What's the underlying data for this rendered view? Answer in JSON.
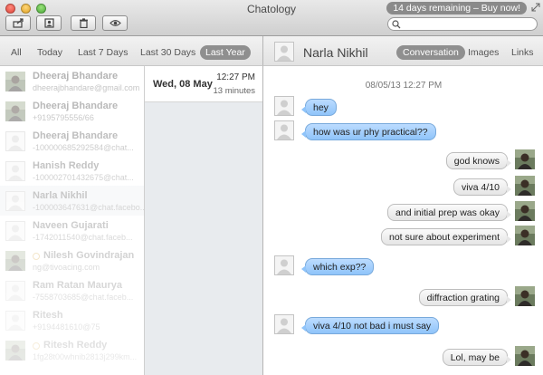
{
  "window": {
    "title": "Chatology",
    "promo": "14 days remaining – Buy now!"
  },
  "toolbar": {
    "buttons": [
      "share-icon",
      "contacts-icon",
      "trash-icon",
      "eye-icon"
    ]
  },
  "search": {
    "value": "",
    "placeholder": ""
  },
  "filters": [
    "All",
    "Today",
    "Last 7 Days",
    "Last 30 Days",
    "Last Year"
  ],
  "active_filter": "Last Year",
  "contacts": [
    {
      "name": "Dheeraj Bhandare",
      "sub": "dheerajbhandare@gmail.com",
      "avatar": "photo",
      "status": false
    },
    {
      "name": "Dheeraj Bhandare",
      "sub": "+9195795556/66",
      "avatar": "photo",
      "status": false
    },
    {
      "name": "Dheeraj Bhandare",
      "sub": "-100000685292584@chat...",
      "avatar": "blank",
      "status": false
    },
    {
      "name": "Hanish Reddy",
      "sub": "-100002701432675@chat...",
      "avatar": "blank",
      "status": false
    },
    {
      "name": "Narla Nikhil",
      "sub": "-100003647631@chat.facebo...",
      "avatar": "blank",
      "status": false,
      "selected": true
    },
    {
      "name": "Naveen Gujarati",
      "sub": "-1742011540@chat.faceb...",
      "avatar": "blank",
      "status": false
    },
    {
      "name": "Nilesh Govindrajan",
      "sub": "ng@tivoacing.com",
      "avatar": "photo",
      "status": true
    },
    {
      "name": "Ram Ratan Maurya",
      "sub": "-7558703685@chat.faceb...",
      "avatar": "blank",
      "status": false
    },
    {
      "name": "Ritesh",
      "sub": "+9194481610@75",
      "avatar": "blank",
      "status": false
    },
    {
      "name": "Ritesh Reddy",
      "sub": "1fg28t00whnib2813j299km...",
      "avatar": "photo",
      "status": true
    }
  ],
  "dates": [
    {
      "label": "Wed, 08 May",
      "time": "12:27 PM",
      "duration": "13 minutes"
    }
  ],
  "conversation": {
    "name": "Narla Nikhil",
    "tabs": [
      "Conversation",
      "Images",
      "Links"
    ],
    "active_tab": "Conversation",
    "timestamp": "08/05/13 12:27 PM",
    "messages": [
      {
        "dir": "in",
        "text": "hey"
      },
      {
        "dir": "in",
        "text": "how was ur phy practical??"
      },
      {
        "dir": "out",
        "text": "god knows"
      },
      {
        "dir": "out",
        "text": "viva 4/10"
      },
      {
        "dir": "out",
        "text": "and initial prep was okay"
      },
      {
        "dir": "out",
        "text": "not sure about experiment"
      },
      {
        "dir": "in",
        "text": "which exp??"
      },
      {
        "dir": "out",
        "text": "diffraction grating"
      },
      {
        "dir": "in",
        "text": "viva 4/10 not bad i must say"
      },
      {
        "dir": "out",
        "text": "Lol, may be"
      }
    ]
  },
  "colors": {
    "incoming_bubble": "#9fcdfb",
    "outgoing_bubble": "#eeeeee",
    "active_pill": "#8f8f8f"
  }
}
